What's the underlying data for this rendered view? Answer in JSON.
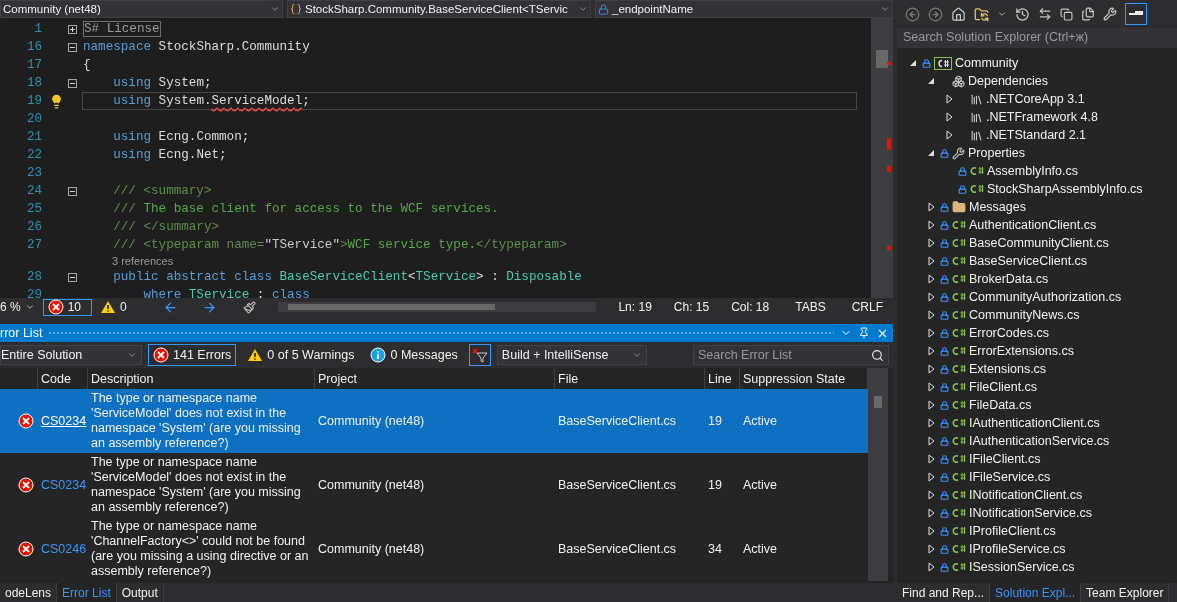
{
  "editor": {
    "nav": {
      "project": "Community (net48)",
      "type": "StockSharp.Community.BaseServiceClient<TServic",
      "member": "_endpointName"
    },
    "lines": [
      {
        "kind": "code",
        "number": "1",
        "folded": true,
        "current": false,
        "lightbulb": false,
        "tokens": [
          {
            "kind": "collapsed",
            "text": "S# License"
          }
        ]
      },
      {
        "kind": "code",
        "number": "16",
        "folded": false,
        "current": false,
        "lightbulb": false,
        "tokens": [
          {
            "kind": "kw",
            "text": "namespace"
          },
          {
            "kind": "text",
            "text": " StockSharp.Community"
          }
        ]
      },
      {
        "kind": "code",
        "number": "17",
        "current": false,
        "lightbulb": false,
        "tokens": [
          {
            "kind": "text",
            "text": "{"
          }
        ]
      },
      {
        "kind": "code",
        "number": "18",
        "folded": false,
        "current": false,
        "lightbulb": false,
        "tokens": [
          {
            "kind": "kw",
            "text": "    using"
          },
          {
            "kind": "text",
            "text": " System;"
          }
        ]
      },
      {
        "kind": "code",
        "number": "19",
        "current": true,
        "lightbulb": true,
        "tokens": [
          {
            "kind": "kw",
            "text": "    using"
          },
          {
            "kind": "text",
            "text": " System."
          },
          {
            "kind": "error",
            "text": "ServiceModel"
          },
          {
            "kind": "text",
            "text": ";"
          }
        ]
      },
      {
        "kind": "code",
        "number": "20",
        "current": false,
        "lightbulb": false
      },
      {
        "kind": "code",
        "number": "21",
        "current": false,
        "lightbulb": false,
        "tokens": [
          {
            "kind": "kw",
            "text": "    using"
          },
          {
            "kind": "text",
            "text": " Ecng.Common;"
          }
        ]
      },
      {
        "kind": "code",
        "number": "22",
        "current": false,
        "lightbulb": false,
        "tokens": [
          {
            "kind": "kw",
            "text": "    using"
          },
          {
            "kind": "text",
            "text": " Ecng.Net;"
          }
        ]
      },
      {
        "kind": "code",
        "number": "23",
        "current": false,
        "lightbulb": false
      },
      {
        "kind": "code",
        "number": "24",
        "folded": false,
        "current": false,
        "lightbulb": false,
        "tokens": [
          {
            "kind": "doc",
            "text": "    /// <summary>"
          }
        ]
      },
      {
        "kind": "code",
        "number": "25",
        "current": false,
        "lightbulb": false,
        "tokens": [
          {
            "kind": "doc",
            "text": "    ///"
          },
          {
            "kind": "comment",
            "text": " The base client for access to the WCF services."
          }
        ]
      },
      {
        "kind": "code",
        "number": "26",
        "current": false,
        "lightbulb": false,
        "tokens": [
          {
            "kind": "doc",
            "text": "    /// </summary>"
          }
        ]
      },
      {
        "kind": "code",
        "number": "27",
        "current": false,
        "lightbulb": false,
        "tokens": [
          {
            "kind": "doc",
            "text": "    /// <typeparam name="
          },
          {
            "kind": "attr",
            "text": "\"TService\""
          },
          {
            "kind": "doc",
            "text": ">"
          },
          {
            "kind": "comment",
            "text": "WCF service type."
          },
          {
            "kind": "doc",
            "text": "</typeparam>"
          }
        ]
      },
      {
        "kind": "codelens",
        "text": "3 references"
      },
      {
        "kind": "code",
        "number": "28",
        "folded": false,
        "current": false,
        "lightbulb": false,
        "tokens": [
          {
            "kind": "kw",
            "text": "    public abstract class "
          },
          {
            "kind": "type",
            "text": "BaseServiceClient"
          },
          {
            "kind": "text",
            "text": "<"
          },
          {
            "kind": "type",
            "text": "TService"
          },
          {
            "kind": "text",
            "text": "> : "
          },
          {
            "kind": "type",
            "text": "Disposable"
          }
        ]
      },
      {
        "kind": "code",
        "number": "29",
        "current": false,
        "lightbulb": false,
        "tokens": [
          {
            "kind": "kw",
            "text": "        where "
          },
          {
            "kind": "type",
            "text": "TService"
          },
          {
            "kind": "text",
            "text": " : "
          },
          {
            "kind": "kw",
            "text": "class"
          }
        ]
      }
    ],
    "status": {
      "zoom": "6 %",
      "errors": "10",
      "warnings": "0",
      "ln": "Ln: 19",
      "ch": "Ch: 15",
      "col": "Col: 18",
      "indent": "TABS",
      "eol": "CRLF"
    }
  },
  "error_list": {
    "title": "rror List",
    "scope": "Entire Solution",
    "filters": [
      {
        "kind": "error",
        "label": "141 Errors",
        "selected": true
      },
      {
        "kind": "warning",
        "label": "0 of 5 Warnings",
        "selected": false
      },
      {
        "kind": "info",
        "label": "0 Messages",
        "selected": false
      }
    ],
    "filter_toggle": {
      "on": true
    },
    "source": "Build + IntelliSense",
    "search": {
      "placeholder": "Search Error List"
    },
    "columns": [
      "Code",
      "Description",
      "Project",
      "File",
      "Line",
      "Suppression State"
    ],
    "rows": [
      {
        "selected": true,
        "code": "CS0234",
        "description": "The type or namespace name 'ServiceModel' does not exist in the namespace 'System' (are you missing an assembly reference?)",
        "project": "Community (net48)",
        "file": "BaseServiceClient.cs",
        "line": "19",
        "state": "Active"
      },
      {
        "selected": false,
        "code": "CS0234",
        "description": "The type or namespace name 'ServiceModel' does not exist in the namespace 'System' (are you missing an assembly reference?)",
        "project": "Community (net48)",
        "file": "BaseServiceClient.cs",
        "line": "19",
        "state": "Active"
      },
      {
        "selected": false,
        "code": "CS0246",
        "description": "The type or namespace name 'ChannelFactory<>' could not be found (are you missing a using directive or an assembly reference?)",
        "project": "Community (net48)",
        "file": "BaseServiceClient.cs",
        "line": "34",
        "state": "Active"
      }
    ]
  },
  "bottom_tabs": [
    {
      "label": "odeLens",
      "selected": false
    },
    {
      "label": "Error List",
      "selected": true
    },
    {
      "label": "Output",
      "selected": false
    }
  ],
  "solution_explorer": {
    "preview_toggle": {
      "on": true
    },
    "search": {
      "placeholder": "Search Solution Explorer (Ctrl+ж)"
    },
    "tree": [
      {
        "kind": "project",
        "label": "Community",
        "expanded": true,
        "children": [
          {
            "kind": "dependencies",
            "label": "Dependencies",
            "expanded": true,
            "children": [
              {
                "kind": "framework",
                "label": ".NETCoreApp 3.1",
                "expanded": false
              },
              {
                "kind": "framework",
                "label": ".NETFramework 4.8",
                "expanded": false
              },
              {
                "kind": "framework",
                "label": ".NETStandard 2.1",
                "expanded": false
              }
            ]
          },
          {
            "kind": "properties",
            "label": "Properties",
            "expanded": true,
            "children": [
              {
                "kind": "cs",
                "label": "AssemblyInfo.cs"
              },
              {
                "kind": "cslink",
                "label": "StockSharpAssemblyInfo.cs"
              }
            ]
          },
          {
            "kind": "folder",
            "label": "Messages",
            "expanded": false
          },
          {
            "kind": "cs",
            "label": "AuthenticationClient.cs",
            "expanded": false
          },
          {
            "kind": "cs",
            "label": "BaseCommunityClient.cs",
            "expanded": false
          },
          {
            "kind": "cs",
            "label": "BaseServiceClient.cs",
            "expanded": false
          },
          {
            "kind": "cs",
            "label": "BrokerData.cs",
            "expanded": false
          },
          {
            "kind": "cs",
            "label": "CommunityAuthorization.cs",
            "expanded": false
          },
          {
            "kind": "cs",
            "label": "CommunityNews.cs",
            "expanded": false
          },
          {
            "kind": "cs",
            "label": "ErrorCodes.cs",
            "expanded": false
          },
          {
            "kind": "cs",
            "label": "ErrorExtensions.cs",
            "expanded": false
          },
          {
            "kind": "cs",
            "label": "Extensions.cs",
            "expanded": false
          },
          {
            "kind": "cs",
            "label": "FileClient.cs",
            "expanded": false
          },
          {
            "kind": "cs",
            "label": "FileData.cs",
            "expanded": false
          },
          {
            "kind": "cs",
            "label": "IAuthenticationClient.cs",
            "expanded": false
          },
          {
            "kind": "cs",
            "label": "IAuthenticationService.cs",
            "expanded": false
          },
          {
            "kind": "cs",
            "label": "IFileClient.cs",
            "expanded": false
          },
          {
            "kind": "cs",
            "label": "IFileService.cs",
            "expanded": false
          },
          {
            "kind": "cs",
            "label": "INotificationClient.cs",
            "expanded": false
          },
          {
            "kind": "cs",
            "label": "INotificationService.cs",
            "expanded": false
          },
          {
            "kind": "cs",
            "label": "IProfileClient.cs",
            "expanded": false
          },
          {
            "kind": "cs",
            "label": "IProfileService.cs",
            "expanded": false
          },
          {
            "kind": "cs",
            "label": "ISessionService.cs",
            "expanded": false
          }
        ]
      }
    ],
    "tabs": [
      {
        "label": "Find and Rep...",
        "selected": false
      },
      {
        "label": "Solution Expl...",
        "selected": true
      },
      {
        "label": "Team Explorer",
        "selected": false
      }
    ]
  }
}
